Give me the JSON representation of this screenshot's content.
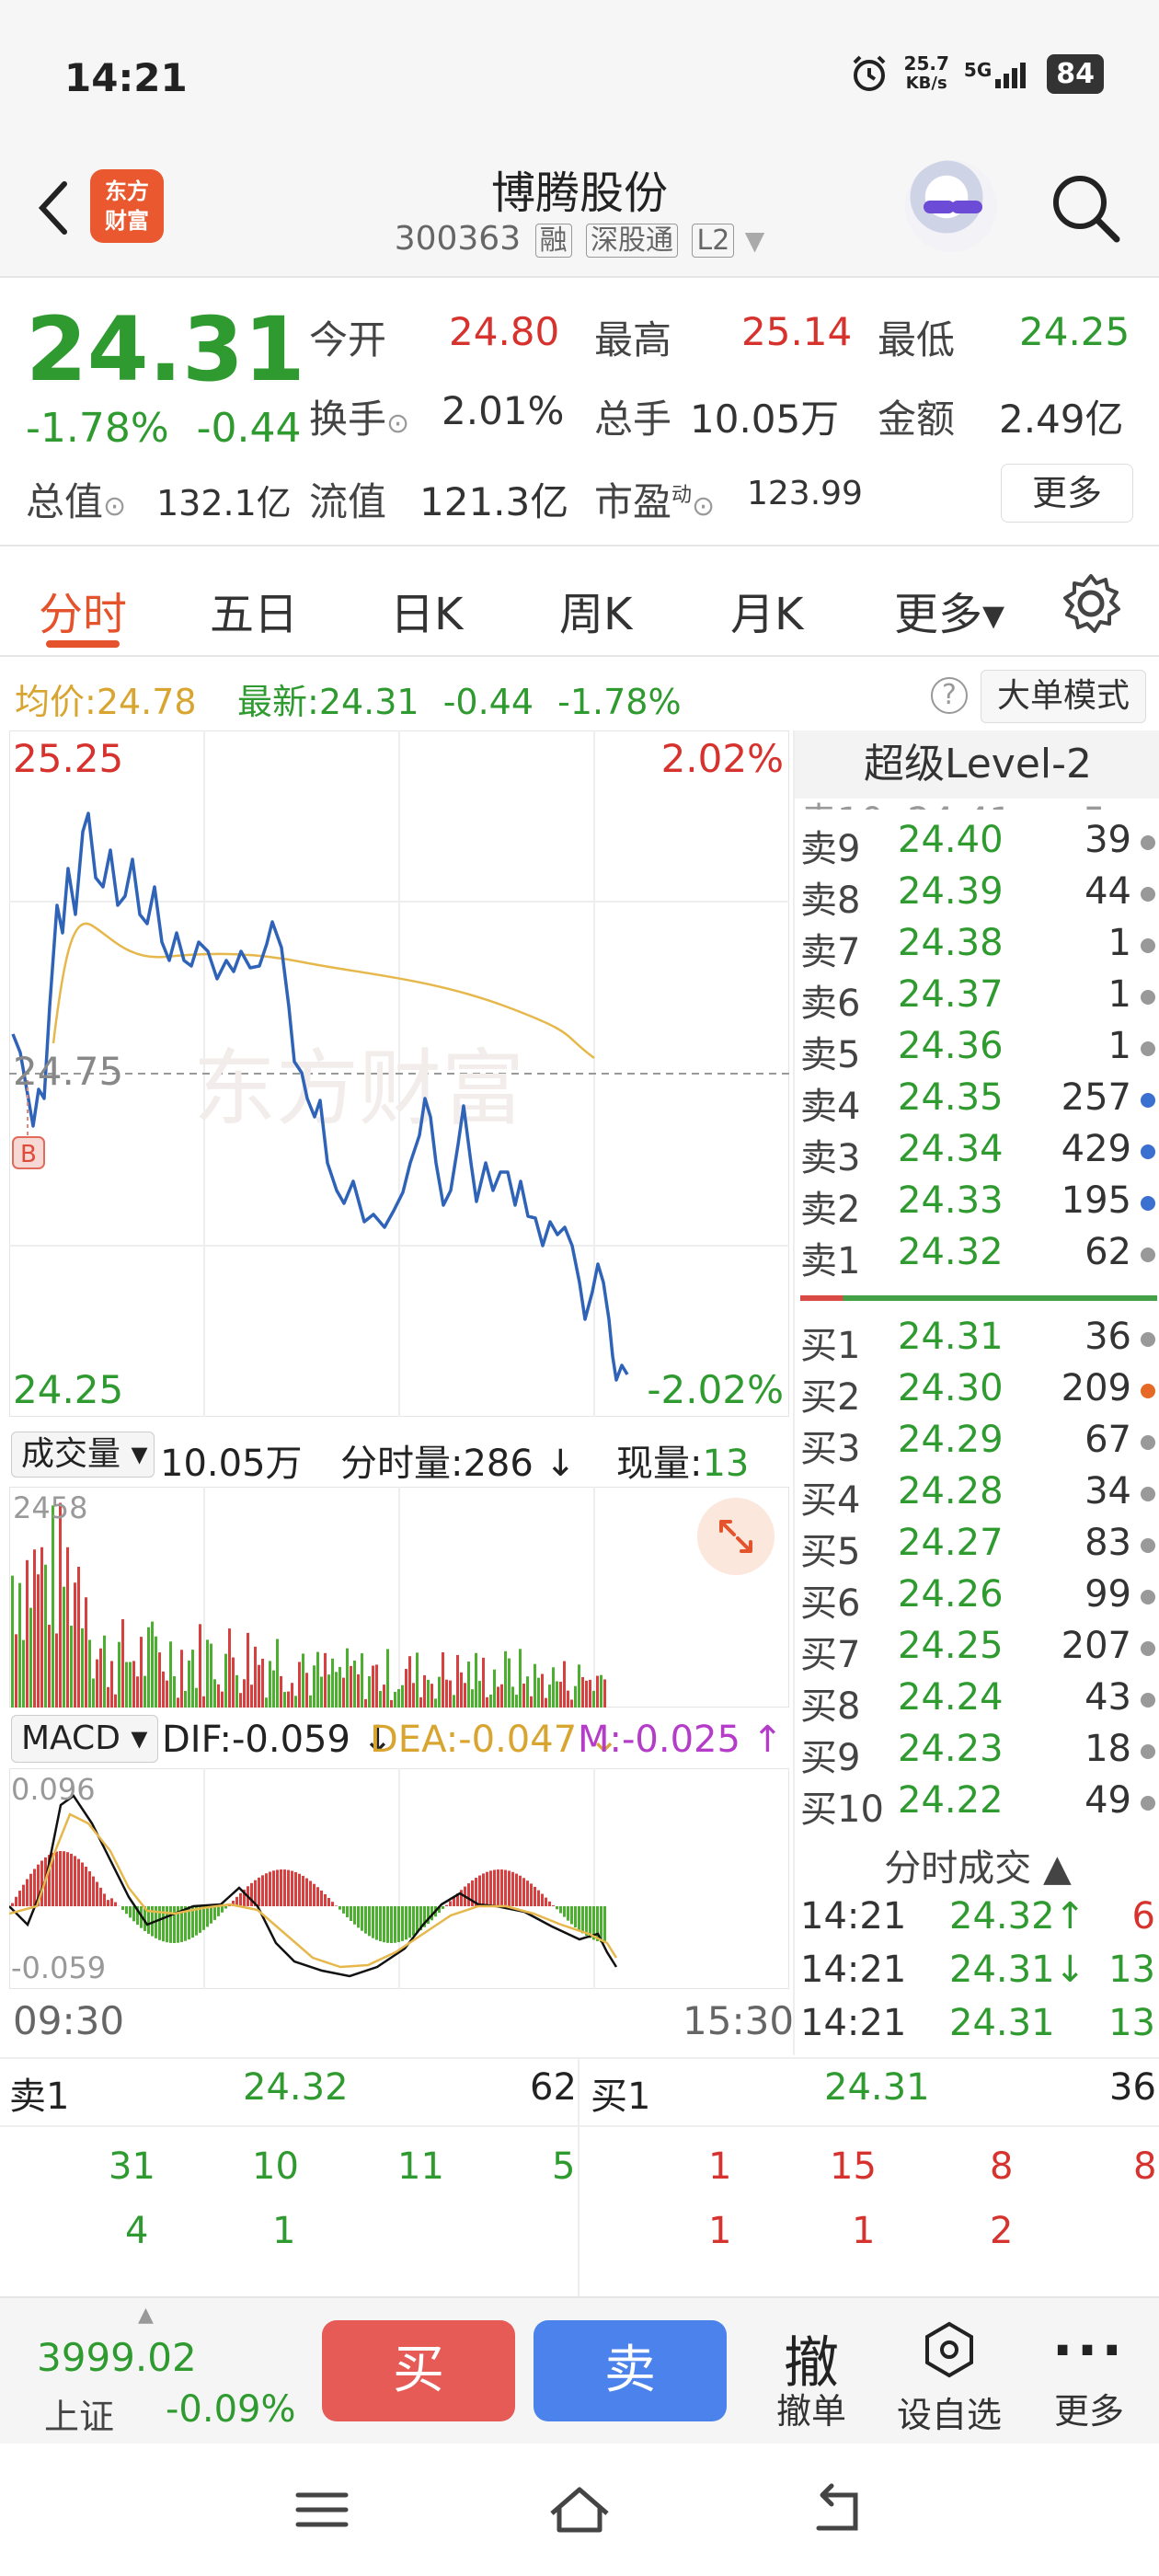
{
  "status": {
    "time": "14:21",
    "speed_top": "25.7",
    "speed_unit": "KB/s",
    "net": "5G",
    "battery": "84"
  },
  "header": {
    "title": "博腾股份",
    "code": "300363",
    "tags": [
      "融",
      "深股通",
      "L2"
    ],
    "logo_line1": "东方",
    "logo_line2": "财富"
  },
  "quote": {
    "price": "24.31",
    "pct": "-1.78%",
    "change": "-0.44",
    "open_label": "今开",
    "open": "24.80",
    "high_label": "最高",
    "high": "25.14",
    "low_label": "最低",
    "low": "24.25",
    "turnover_label": "换手",
    "turnover": "2.01%",
    "volume_label": "总手",
    "volume": "10.05万",
    "amount_label": "金额",
    "amount": "2.49亿",
    "mktcap_label": "总值",
    "mktcap": "132.1亿",
    "float_label": "流值",
    "float": "121.3亿",
    "pe_label": "市盈",
    "pe_sup": "动",
    "pe": "123.99",
    "more": "更多"
  },
  "tabs": [
    "分时",
    "五日",
    "日K",
    "周K",
    "月K",
    "更多▾"
  ],
  "infoline": {
    "avg_label": "均价:",
    "avg": "24.78",
    "latest_label": "最新:",
    "latest": "24.31",
    "chg": "-0.44",
    "pct": "-1.78%",
    "bigmode": "大单模式",
    "help": "?"
  },
  "chart": {
    "top_price": "25.25",
    "top_pct": "2.02%",
    "mid_price": "24.75",
    "bottom_price": "24.25",
    "bottom_pct": "-2.02%",
    "buy_marker": "B",
    "watermark": "东方财富"
  },
  "volume": {
    "selector": "成交量 ▾",
    "total": "10.05万",
    "fenshi": "分时量:286 ↓",
    "xianliang_label": "现量:",
    "xianliang": "13",
    "max": "2458"
  },
  "macd": {
    "selector": "MACD ▾",
    "dif": "DIF:-0.059 ↓",
    "dea": "DEA:-0.047 ↓",
    "m": "M:-0.025 ↑",
    "top": "0.096",
    "bottom": "-0.059",
    "t_start": "09:30",
    "t_end": "15:30"
  },
  "book": {
    "title": "超级Level-2",
    "sells": [
      {
        "label": "卖9",
        "price": "24.40",
        "vol": "39",
        "dot": "#999999"
      },
      {
        "label": "卖8",
        "price": "24.39",
        "vol": "44",
        "dot": "#999999"
      },
      {
        "label": "卖7",
        "price": "24.38",
        "vol": "1",
        "dot": "#999999"
      },
      {
        "label": "卖6",
        "price": "24.37",
        "vol": "1",
        "dot": "#999999"
      },
      {
        "label": "卖5",
        "price": "24.36",
        "vol": "1",
        "dot": "#999999"
      },
      {
        "label": "卖4",
        "price": "24.35",
        "vol": "257",
        "dot": "#3b6fd0"
      },
      {
        "label": "卖3",
        "price": "24.34",
        "vol": "429",
        "dot": "#3b6fd0"
      },
      {
        "label": "卖2",
        "price": "24.33",
        "vol": "195",
        "dot": "#3b6fd0"
      },
      {
        "label": "卖1",
        "price": "24.32",
        "vol": "62",
        "dot": "#999999"
      }
    ],
    "buys": [
      {
        "label": "买1",
        "price": "24.31",
        "vol": "36",
        "dot": "#999999"
      },
      {
        "label": "买2",
        "price": "24.30",
        "vol": "209",
        "dot": "#e56a28"
      },
      {
        "label": "买3",
        "price": "24.29",
        "vol": "67",
        "dot": "#999999"
      },
      {
        "label": "买4",
        "price": "24.28",
        "vol": "34",
        "dot": "#999999"
      },
      {
        "label": "买5",
        "price": "24.27",
        "vol": "83",
        "dot": "#999999"
      },
      {
        "label": "买6",
        "price": "24.26",
        "vol": "99",
        "dot": "#999999"
      },
      {
        "label": "买7",
        "price": "24.25",
        "vol": "207",
        "dot": "#999999"
      },
      {
        "label": "买8",
        "price": "24.24",
        "vol": "43",
        "dot": "#999999"
      },
      {
        "label": "买9",
        "price": "24.23",
        "vol": "18",
        "dot": "#999999"
      },
      {
        "label": "买10",
        "price": "24.22",
        "vol": "49",
        "dot": "#999999"
      }
    ],
    "trades_title": "分时成交 ▲",
    "trades": [
      {
        "time": "14:21",
        "price": "24.32↑",
        "vol": "6",
        "dir": "up"
      },
      {
        "time": "14:21",
        "price": "24.31↓",
        "vol": "13",
        "dir": "down"
      },
      {
        "time": "14:21",
        "price": "24.31",
        "vol": "13",
        "dir": "flat"
      }
    ]
  },
  "smallbook": {
    "sell_label": "卖1",
    "sell_price": "24.32",
    "sell_vol": "62",
    "buy_label": "买1",
    "buy_price": "24.31",
    "buy_vol": "36",
    "sell_row1": [
      "31",
      "10",
      "11",
      "5"
    ],
    "sell_row2": [
      "4",
      "1"
    ],
    "buy_row1": [
      "1",
      "15",
      "8",
      "8"
    ],
    "buy_row2": [
      "1",
      "1",
      "2"
    ]
  },
  "actions": {
    "index_value": "3999.02",
    "index_name": "上证",
    "index_chg": "-0.09%",
    "buy": "买",
    "sell": "卖",
    "cancel_icon": "撤",
    "cancel": "撤单",
    "watch": "设自选",
    "more": "更多"
  }
}
